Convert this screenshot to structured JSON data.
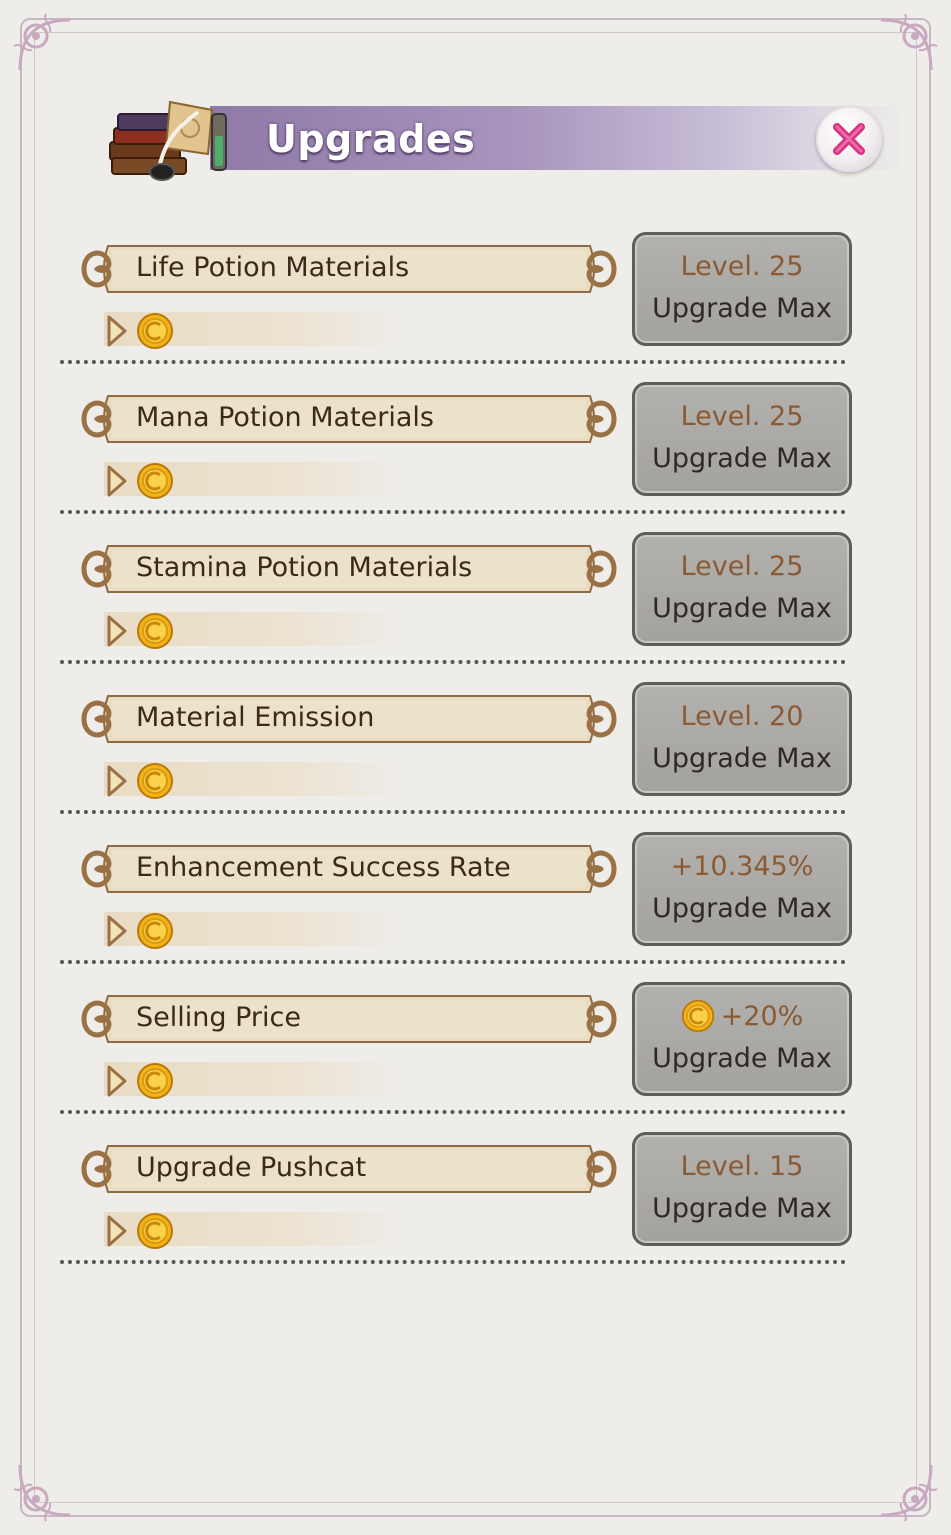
{
  "window": {
    "title": "Upgrades"
  },
  "rows": [
    {
      "label": "Life Potion Materials",
      "status_line1": "Level. 25",
      "status_line2": "Upgrade Max",
      "status_has_coin": false
    },
    {
      "label": "Mana Potion Materials",
      "status_line1": "Level. 25",
      "status_line2": "Upgrade Max",
      "status_has_coin": false
    },
    {
      "label": "Stamina Potion Materials",
      "status_line1": "Level. 25",
      "status_line2": "Upgrade Max",
      "status_has_coin": false
    },
    {
      "label": "Material Emission",
      "status_line1": "Level. 20",
      "status_line2": "Upgrade Max",
      "status_has_coin": false
    },
    {
      "label": "Enhancement Success Rate",
      "status_line1": "+10.345%",
      "status_line2": "Upgrade Max",
      "status_has_coin": false
    },
    {
      "label": "Selling Price",
      "status_line1": "+20%",
      "status_line2": "Upgrade Max",
      "status_has_coin": true
    },
    {
      "label": "Upgrade Pushcat",
      "status_line1": "Level. 15",
      "status_line2": "Upgrade Max",
      "status_has_coin": false
    }
  ],
  "icons": {
    "header": "books-scroll-icon",
    "close": "close-icon",
    "row_arrow": "arrow-right-icon",
    "row_currency": "gold-coin-icon"
  },
  "colors": {
    "header_band": "#a895bd",
    "button_face": "#a8a7a3",
    "level_text": "#8a5a34",
    "close_x": "#d8337f",
    "coin": "#f2b318"
  }
}
